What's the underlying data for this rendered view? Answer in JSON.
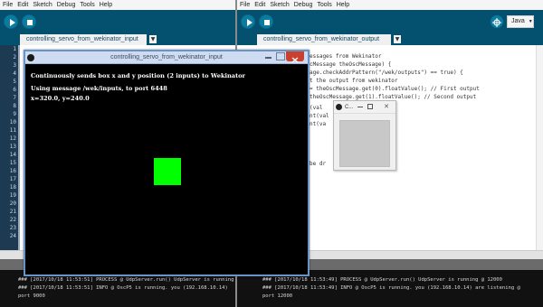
{
  "left_ide": {
    "menus": [
      "File",
      "Edit",
      "Sketch",
      "Debug",
      "Tools",
      "Help"
    ],
    "tab_label": "controlling_servo_from_wekinator_input",
    "line_numbers": [
      "1",
      "2",
      "3",
      "4",
      "5",
      "6",
      "7",
      "8",
      "9",
      "10",
      "11",
      "12",
      "13",
      "14",
      "15",
      "16",
      "17",
      "18",
      "19",
      "20",
      "21",
      "22",
      "23",
      "24"
    ],
    "console_lines": [
      "### [2017/10/18 11:53:51] PROCESS @ UdpServer.run() UdpServer is running",
      "### [2017/10/18 11:53:51] INFO @ OscP5 is running. you (192.168.10.14)",
      "port 9000"
    ]
  },
  "right_ide": {
    "menus": [
      "File",
      "Edit",
      "Sketch",
      "Debug",
      "Tools",
      "Help"
    ],
    "tab_label": "controlling_servo_from_wekinator_output",
    "mode_label": "Java",
    "code_lines": [
      "essages from Wekinator",
      "cMessage theOscMessage) {",
      "age.checkAddrPattern(\"/wek/outputs\") == true) {",
      "t the output from wekinator",
      "= theOscMessage.get(0).floatValue(); // First output",
      "theOscMessage.get(1).floatValue(); // Second output",
      "(val",
      "nt(val",
      "nt(va",
      "be dr"
    ],
    "console_lines": [
      "### [2017/10/18 11:53:49] PROCESS @ UdpServer.run() UdpServer is running @ 12000",
      "### [2017/10/18 11:53:49] INFO @ OscP5 is running. you (192.168.10.14) are listening @",
      "port 12000"
    ]
  },
  "sketch_window": {
    "title": "controlling_servo_from_wekinator_input",
    "line1": "Continuously sends box x and y position (2 inputs) to Wekinator",
    "line2": "Using message /wek/inputs, to port 6448",
    "line3": "x=320.0, y=240.0",
    "box_color": "#00ff00"
  },
  "output_window": {
    "title": "C..."
  },
  "colors": {
    "toolbar": "#03506f",
    "button": "#0c7ba0",
    "console_bg": "#111111",
    "window_border": "#6a93c8"
  }
}
